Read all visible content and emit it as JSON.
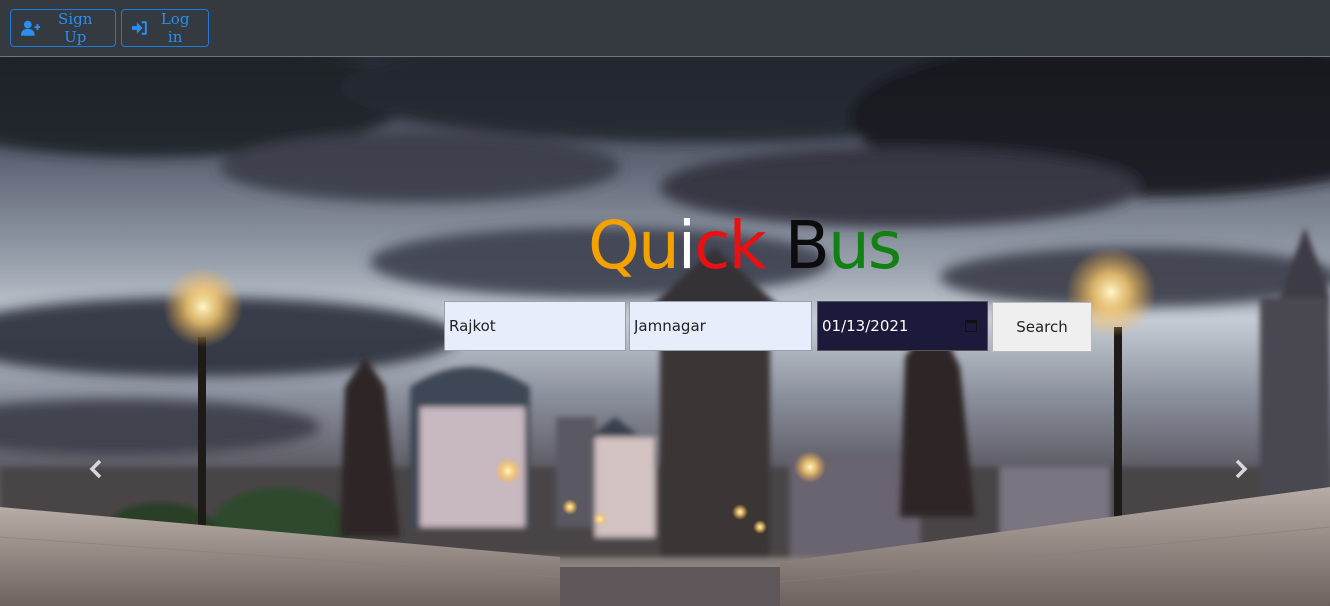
{
  "navbar": {
    "signup_label": "Sign Up",
    "login_label": "Log in"
  },
  "brand": {
    "letters": [
      {
        "char": "Q",
        "color": "#f5a100"
      },
      {
        "char": "u",
        "color": "#f5a100"
      },
      {
        "char": "i",
        "color": "#ffffff"
      },
      {
        "char": "c",
        "color": "#e81010"
      },
      {
        "char": "k",
        "color": "#e81010"
      },
      {
        "char": "B",
        "color": "#0c0c0c"
      },
      {
        "char": "u",
        "color": "#128012"
      },
      {
        "char": "s",
        "color": "#128012"
      }
    ]
  },
  "search": {
    "from_value": "Rajkot",
    "to_value": "Jamnagar",
    "date_value": "01/13/2021",
    "button_label": "Search"
  },
  "carousel": {
    "prev_icon": "chevron-left-icon",
    "next_icon": "chevron-right-icon"
  },
  "colors": {
    "navbar_bg": "#343a40",
    "button_accent": "#1e7bd8"
  }
}
